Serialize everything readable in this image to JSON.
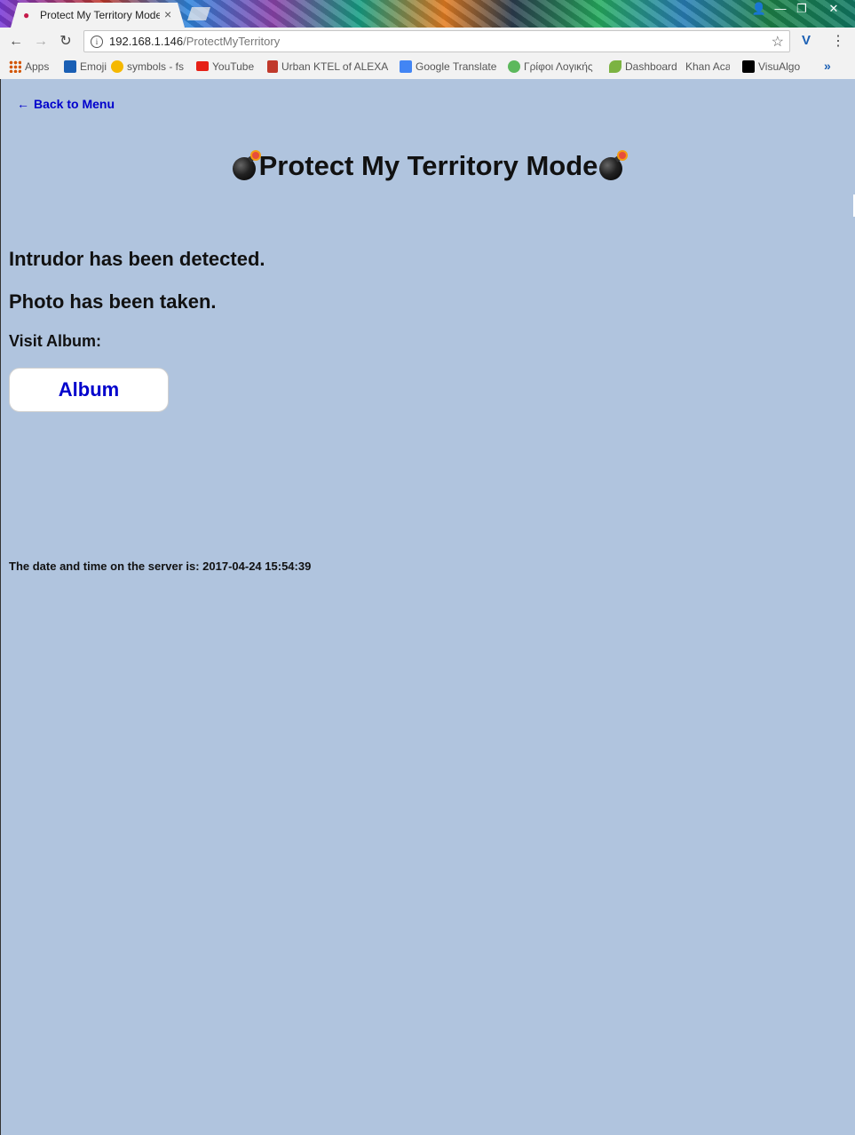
{
  "browser": {
    "tab": {
      "title": "Protect My Territory Mode",
      "close_glyph": "×",
      "favicon": "raspberry-icon"
    },
    "window_controls": {
      "profile": "👤",
      "minimize": "—",
      "restore": "❐",
      "close": "✕"
    },
    "nav": {
      "back": "←",
      "forward": "→",
      "reload": "↻"
    },
    "address": {
      "host": "192.168.1.146",
      "path": "/ProtectMyTerritory",
      "info_glyph": "i",
      "star_glyph": "☆"
    },
    "extension_glyph": "V",
    "menu_glyph": "⋮",
    "bookmarks": [
      {
        "label": "Apps",
        "icon": "apps-grid-icon",
        "color": "#d35400"
      },
      {
        "label": "Emoji",
        "icon": "heart-icon",
        "color": "#1a5fb4"
      },
      {
        "label": "symbols - fs",
        "icon": "smiley-icon",
        "color": "#f5b800"
      },
      {
        "label": "YouTube",
        "icon": "youtube-icon",
        "color": "#e62117"
      },
      {
        "label": "Urban KTEL of ALEXA",
        "icon": "ktel-icon",
        "color": "#c0392b"
      },
      {
        "label": "Google Translate",
        "icon": "translate-icon",
        "color": "#4285f4"
      },
      {
        "label": "Γρίφοι Λογικής",
        "icon": "puzzle-icon",
        "color": "#5cb85c"
      },
      {
        "label": "Dashboard",
        "icon": "leaf-icon",
        "color": "#7cb342"
      },
      {
        "label": "Khan Aca",
        "icon": "khan-icon",
        "color": "#ffffff"
      },
      {
        "label": "VisuAlgo",
        "icon": "visualgo-icon",
        "color": "#000000"
      }
    ],
    "bookmarks_more": "»"
  },
  "page": {
    "back_link": {
      "arrow": "←",
      "label": "Back to Menu"
    },
    "title": "Protect My Territory Mode",
    "messages": [
      "Intrudor has been detected.",
      "Photo has been taken."
    ],
    "visit_label": "Visit Album:",
    "album_button": "Album",
    "server_time": "The date and time on the server is: 2017-04-24 15:54:39"
  },
  "colors": {
    "page_background": "#b0c4de",
    "link": "#0000cc",
    "browser_chrome": "#f2f2f2"
  }
}
